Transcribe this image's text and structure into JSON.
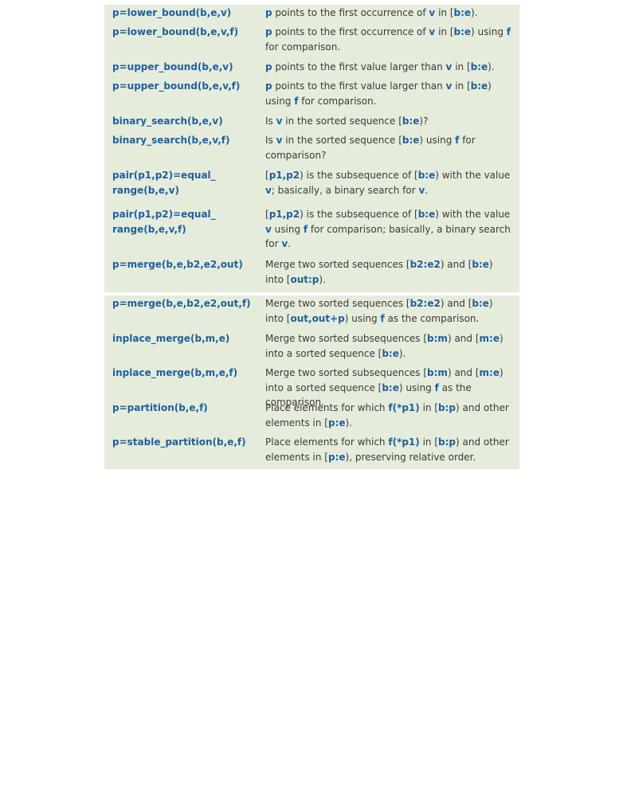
{
  "blocks": [
    {
      "rows": [
        {
          "fn": "p=lower_bound(b,e,v)",
          "desc": [
            {
              "t": "p",
              "b": true
            },
            {
              "t": " points to the first occurrence of "
            },
            {
              "t": "v",
              "b": true
            },
            {
              "t": " in ["
            },
            {
              "t": "b:e",
              "b": true
            },
            {
              "t": ")."
            }
          ]
        },
        {
          "fn": "p=lower_bound(b,e,v,f)",
          "desc": [
            {
              "t": "p",
              "b": true
            },
            {
              "t": " points to the first occurrence of "
            },
            {
              "t": "v",
              "b": true
            },
            {
              "t": " in ["
            },
            {
              "t": "b:e",
              "b": true
            },
            {
              "t": ") using "
            },
            {
              "t": "f",
              "b": true
            },
            {
              "t": " for comparison."
            }
          ]
        },
        {
          "fn": "p=upper_bound(b,e,v)",
          "desc": [
            {
              "t": "p",
              "b": true
            },
            {
              "t": " points to the first value larger than "
            },
            {
              "t": "v",
              "b": true
            },
            {
              "t": " in ["
            },
            {
              "t": "b:e",
              "b": true
            },
            {
              "t": ")."
            }
          ]
        },
        {
          "fn": "p=upper_bound(b,e,v,f)",
          "desc": [
            {
              "t": "p",
              "b": true
            },
            {
              "t": " points to the first value larger than "
            },
            {
              "t": "v",
              "b": true
            },
            {
              "t": " in ["
            },
            {
              "t": "b:e",
              "b": true
            },
            {
              "t": ") using "
            },
            {
              "t": "f",
              "b": true
            },
            {
              "t": " for comparison."
            }
          ]
        },
        {
          "fn": "binary_search(b,e,v)",
          "desc": [
            {
              "t": "Is "
            },
            {
              "t": "v",
              "b": true
            },
            {
              "t": " in the sorted sequence ["
            },
            {
              "t": "b:e",
              "b": true
            },
            {
              "t": ")?"
            }
          ]
        },
        {
          "fn": "binary_search(b,e,v,f)",
          "desc": [
            {
              "t": "Is "
            },
            {
              "t": "v",
              "b": true
            },
            {
              "t": " in the sorted sequence ["
            },
            {
              "t": "b:e",
              "b": true
            },
            {
              "t": ") using "
            },
            {
              "t": "f",
              "b": true
            },
            {
              "t": " for comparison?"
            }
          ]
        },
        {
          "fn": "pair(p1,p2)=equal_\nrange(b,e,v)",
          "desc": [
            {
              "t": "["
            },
            {
              "t": "p1,p2",
              "b": true
            },
            {
              "t": ") is the subsequence of ["
            },
            {
              "t": "b:e",
              "b": true
            },
            {
              "t": ") with the value "
            },
            {
              "t": "v",
              "b": true
            },
            {
              "t": "; basically, a binary search for "
            },
            {
              "t": "v",
              "b": true
            },
            {
              "t": "."
            }
          ]
        },
        {
          "fn": "pair(p1,p2)=equal_\nrange(b,e,v,f)",
          "desc": [
            {
              "t": "["
            },
            {
              "t": "p1,p2",
              "b": true
            },
            {
              "t": ") is the subsequence of ["
            },
            {
              "t": "b:e",
              "b": true
            },
            {
              "t": ") with the value "
            },
            {
              "t": "v",
              "b": true
            },
            {
              "t": " using "
            },
            {
              "t": "f",
              "b": true
            },
            {
              "t": " for comparison; basically, a binary search for "
            },
            {
              "t": "v",
              "b": true
            },
            {
              "t": "."
            }
          ]
        },
        {
          "fn": "p=merge(b,e,b2,e2,out)",
          "desc": [
            {
              "t": "Merge two sorted sequences ["
            },
            {
              "t": "b2:e2",
              "b": true
            },
            {
              "t": ") and ["
            },
            {
              "t": "b:e",
              "b": true
            },
            {
              "t": ") into ["
            },
            {
              "t": "out:p",
              "b": true
            },
            {
              "t": ")."
            }
          ]
        }
      ]
    },
    {
      "rows": [
        {
          "fn": "p=merge(b,e,b2,e2,out,f)",
          "desc": [
            {
              "t": "Merge two sorted sequences ["
            },
            {
              "t": "b2:e2",
              "b": true
            },
            {
              "t": ") and ["
            },
            {
              "t": "b:e",
              "b": true
            },
            {
              "t": ") into ["
            },
            {
              "t": "out,out+p",
              "b": true
            },
            {
              "t": ") using "
            },
            {
              "t": "f",
              "b": true
            },
            {
              "t": " as the comparison."
            }
          ]
        },
        {
          "fn": "inplace_merge(b,m,e)",
          "desc": [
            {
              "t": "Merge two sorted subsequences ["
            },
            {
              "t": "b:m",
              "b": true
            },
            {
              "t": ") and ["
            },
            {
              "t": "m:e",
              "b": true
            },
            {
              "t": ") into a sorted sequence ["
            },
            {
              "t": "b:e",
              "b": true
            },
            {
              "t": ")."
            }
          ]
        },
        {
          "fn": "inplace_merge(b,m,e,f)",
          "desc": [
            {
              "t": "Merge two sorted subsequences ["
            },
            {
              "t": "b:m",
              "b": true
            },
            {
              "t": ") and ["
            },
            {
              "t": "m:e",
              "b": true
            },
            {
              "t": ") into a sorted sequence ["
            },
            {
              "t": "b:e",
              "b": true
            },
            {
              "t": ") using "
            },
            {
              "t": "f",
              "b": true
            },
            {
              "t": " as the comparison."
            }
          ]
        },
        {
          "fn": "p=partition(b,e,f)",
          "desc": [
            {
              "t": "Place elements for which "
            },
            {
              "t": "f(*p1)",
              "b": true
            },
            {
              "t": " in ["
            },
            {
              "t": "b:p",
              "b": true
            },
            {
              "t": ") and other elements in ["
            },
            {
              "t": "p:e",
              "b": true
            },
            {
              "t": ")."
            }
          ]
        },
        {
          "fn": "p=stable_partition(b,e,f)",
          "desc": [
            {
              "t": "Place elements for which "
            },
            {
              "t": "f(*p1)",
              "b": true
            },
            {
              "t": " in ["
            },
            {
              "t": "b:p",
              "b": true
            },
            {
              "t": ") and other elements in ["
            },
            {
              "t": "p:e",
              "b": true
            },
            {
              "t": "), preserving relative order."
            }
          ]
        }
      ]
    }
  ]
}
